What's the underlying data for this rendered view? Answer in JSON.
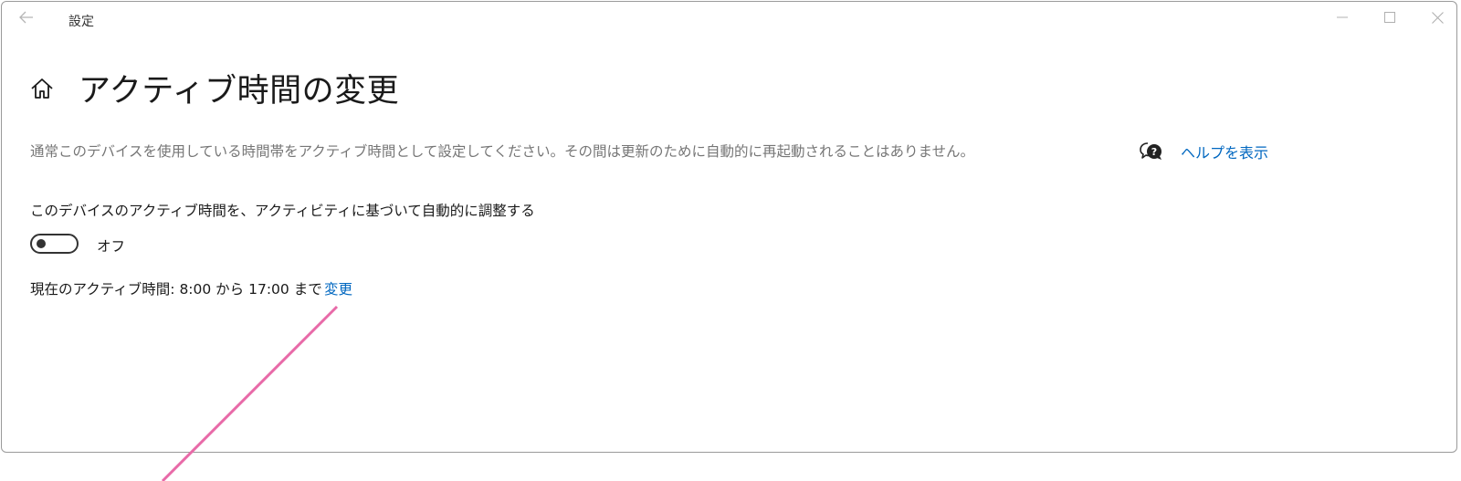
{
  "window": {
    "app_title": "設定"
  },
  "page": {
    "title": "アクティブ時間の変更",
    "description": "通常このデバイスを使用している時間帯をアクティブ時間として設定してください。その間は更新のために自動的に再起動されることはありません。",
    "help_link": "ヘルプを表示"
  },
  "auto_adjust": {
    "label": "このデバイスのアクティブ時間を、アクティビティに基づいて自動的に調整する",
    "toggle_state": "オフ",
    "toggle_on": false
  },
  "current_hours": {
    "text": "現在のアクティブ時間: 8:00 から 17:00 まで",
    "change_link": "変更"
  },
  "icons": {
    "back": "back-arrow-icon",
    "home": "home-icon",
    "help": "help-chat-icon",
    "minimize": "minimize-icon",
    "maximize": "maximize-icon",
    "close": "close-icon"
  },
  "colors": {
    "link": "#0067c0",
    "description": "#767676",
    "annotation_line": "#e86aa8"
  }
}
